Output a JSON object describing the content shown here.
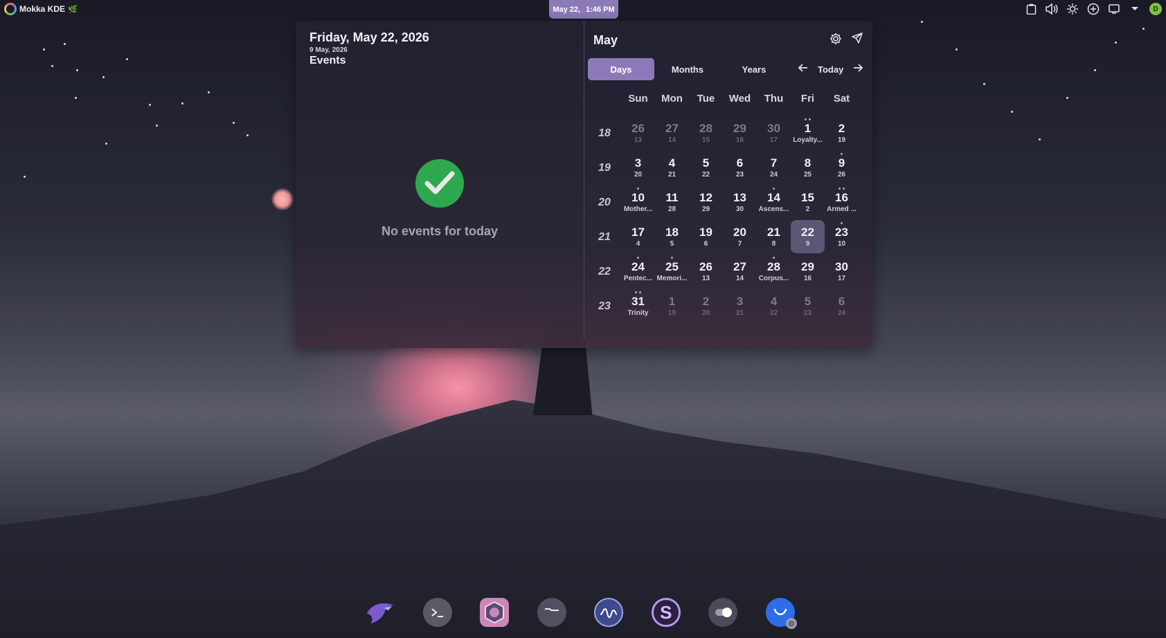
{
  "top_panel": {
    "app_name": "Mokka KDE",
    "clock": {
      "date": "May 22,",
      "time": "1:46 PM"
    },
    "user_initial": "D",
    "tray_icons": [
      "clipboard-icon",
      "volume-icon",
      "brightness-icon",
      "network-icon",
      "display-icon",
      "expand-tray-icon"
    ]
  },
  "events_pane": {
    "date_title": "Friday, May 22, 2026",
    "alt_date": "9 May, 2026",
    "events_title": "Events",
    "no_events_text": "No events for today"
  },
  "calendar": {
    "month_title": "May",
    "tabs": [
      "Days",
      "Months",
      "Years"
    ],
    "active_tab": "Days",
    "today_label": "Today",
    "weekdays": [
      "Sun",
      "Mon",
      "Tue",
      "Wed",
      "Thu",
      "Fri",
      "Sat"
    ],
    "weeks": [
      {
        "week": "18",
        "days": [
          {
            "n": "26",
            "s": "13",
            "other": true
          },
          {
            "n": "27",
            "s": "14",
            "other": true
          },
          {
            "n": "28",
            "s": "15",
            "other": true
          },
          {
            "n": "29",
            "s": "16",
            "other": true
          },
          {
            "n": "30",
            "s": "17",
            "other": true
          },
          {
            "n": "1",
            "s": "Loyalty...",
            "dots": 2
          },
          {
            "n": "2",
            "s": "19"
          }
        ]
      },
      {
        "week": "19",
        "days": [
          {
            "n": "3",
            "s": "20"
          },
          {
            "n": "4",
            "s": "21"
          },
          {
            "n": "5",
            "s": "22"
          },
          {
            "n": "6",
            "s": "23"
          },
          {
            "n": "7",
            "s": "24"
          },
          {
            "n": "8",
            "s": "25"
          },
          {
            "n": "9",
            "s": "26",
            "dots": 1
          }
        ]
      },
      {
        "week": "20",
        "days": [
          {
            "n": "10",
            "s": "Mother...",
            "dots": 1
          },
          {
            "n": "11",
            "s": "28"
          },
          {
            "n": "12",
            "s": "29"
          },
          {
            "n": "13",
            "s": "30"
          },
          {
            "n": "14",
            "s": "Ascens...",
            "dots": 1
          },
          {
            "n": "15",
            "s": "2"
          },
          {
            "n": "16",
            "s": "Armed ...",
            "dots": 2
          }
        ]
      },
      {
        "week": "21",
        "days": [
          {
            "n": "17",
            "s": "4"
          },
          {
            "n": "18",
            "s": "5"
          },
          {
            "n": "19",
            "s": "6"
          },
          {
            "n": "20",
            "s": "7"
          },
          {
            "n": "21",
            "s": "8"
          },
          {
            "n": "22",
            "s": "9",
            "today": true
          },
          {
            "n": "23",
            "s": "10",
            "dots": 1
          }
        ]
      },
      {
        "week": "22",
        "days": [
          {
            "n": "24",
            "s": "Pentec...",
            "dots": 1
          },
          {
            "n": "25",
            "s": "Memori...",
            "dots": 1
          },
          {
            "n": "26",
            "s": "13"
          },
          {
            "n": "27",
            "s": "14"
          },
          {
            "n": "28",
            "s": "Corpus...",
            "dots": 1
          },
          {
            "n": "29",
            "s": "16"
          },
          {
            "n": "30",
            "s": "17"
          }
        ]
      },
      {
        "week": "23",
        "days": [
          {
            "n": "31",
            "s": "Trinity",
            "dots": 2
          },
          {
            "n": "1",
            "s": "19",
            "other": true
          },
          {
            "n": "2",
            "s": "20",
            "other": true
          },
          {
            "n": "3",
            "s": "21",
            "other": true
          },
          {
            "n": "4",
            "s": "22",
            "other": true
          },
          {
            "n": "5",
            "s": "23",
            "other": true
          },
          {
            "n": "6",
            "s": "24",
            "other": true
          }
        ]
      }
    ]
  },
  "dock": {
    "apps": [
      {
        "name": "eagle-app",
        "icon": "eagle-icon"
      },
      {
        "name": "terminal-app",
        "icon": "terminal-icon"
      },
      {
        "name": "hexagon-app",
        "icon": "hexagon-icon"
      },
      {
        "name": "files-app",
        "icon": "folder-icon"
      },
      {
        "name": "system-monitor-app",
        "icon": "waveform-icon"
      },
      {
        "name": "s-app",
        "icon": "s-letter-icon"
      },
      {
        "name": "settings-toggle-app",
        "icon": "toggle-icon"
      },
      {
        "name": "discover-app",
        "icon": "smile-icon"
      }
    ]
  },
  "colors": {
    "accent": "#8c7ab8",
    "today_bg": "#5c5677",
    "event_dot": "#b59ce6",
    "success": "#2ea84f"
  }
}
